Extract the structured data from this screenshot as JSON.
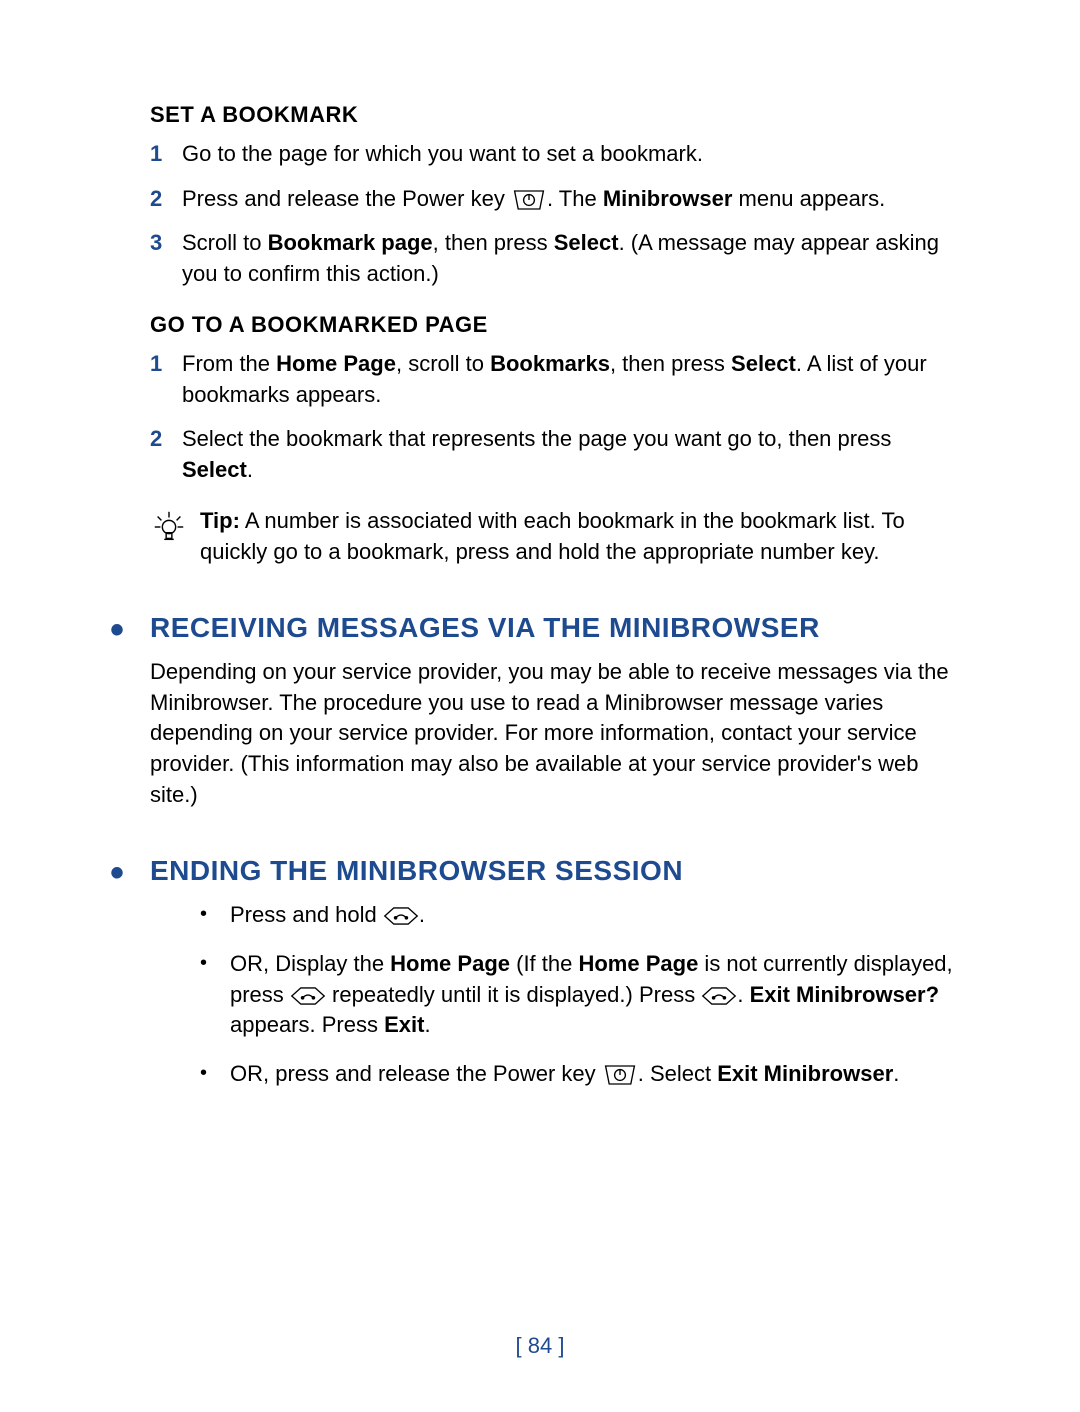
{
  "section1": {
    "heading": "SET A BOOKMARK",
    "items": [
      {
        "num": "1",
        "text": "Go to the page for which you want to set a bookmark."
      },
      {
        "num": "2",
        "pre": "Press and release the Power key ",
        "post1": ". The ",
        "bold1": "Minibrowser",
        "post2": " menu appears."
      },
      {
        "num": "3",
        "pre": "Scroll to ",
        "bold1": "Bookmark page",
        "mid": ", then press ",
        "bold2": "Select",
        "post": ". (A message may appear asking you to confirm this action.)"
      }
    ]
  },
  "section2": {
    "heading": "GO TO A BOOKMARKED PAGE",
    "items": [
      {
        "num": "1",
        "pre": "From the ",
        "bold1": "Home Page",
        "mid1": ", scroll to ",
        "bold2": "Bookmarks",
        "mid2": ", then press ",
        "bold3": "Select",
        "post": ". A list of your bookmarks appears."
      },
      {
        "num": "2",
        "pre": "Select the bookmark that represents the page you want go to, then press ",
        "bold1": "Select",
        "post": "."
      }
    ],
    "tip": {
      "label": "Tip:",
      "text": " A number is associated with each bookmark in the bookmark list. To quickly go to a bookmark, press and hold the appropriate number key."
    }
  },
  "section3": {
    "heading": "RECEIVING MESSAGES VIA THE MINIBROWSER",
    "body": "Depending on your service provider, you may be able to receive messages via the Minibrowser. The procedure you use to read a Minibrowser message varies depending on your service provider. For more information, contact your service provider. (This information may also be available at your service provider's web site.)"
  },
  "section4": {
    "heading": "ENDING THE MINIBROWSER SESSION",
    "items": [
      {
        "pre": "Press and hold ",
        "post": "."
      },
      {
        "pre": "OR, Display the ",
        "bold1": "Home Page",
        "mid1": " (If the ",
        "bold2": "Home Page",
        "mid2": " is not currently displayed, press ",
        "mid3": " repeatedly until it is displayed.) Press ",
        "post1": ". ",
        "bold3": "Exit Minibrowser?",
        "mid4": " appears. Press ",
        "bold4": "Exit",
        "post2": "."
      },
      {
        "pre": "OR, press and release the Power key ",
        "mid": ". Select ",
        "bold1": "Exit Minibrowser",
        "post": "."
      }
    ]
  },
  "pageNumber": "[ 84 ]"
}
